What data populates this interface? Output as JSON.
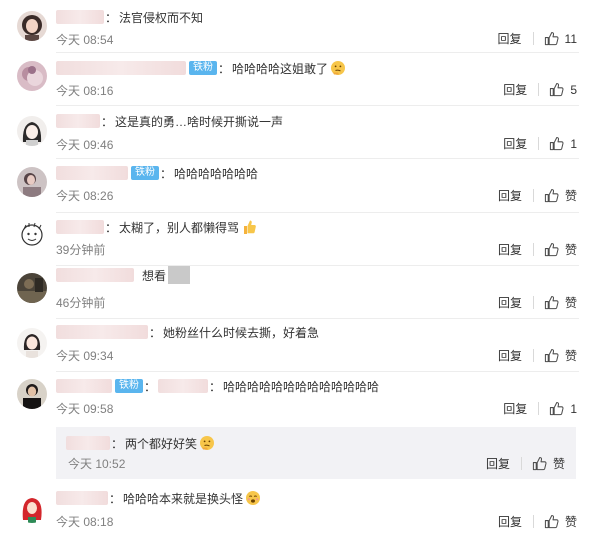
{
  "colors": {
    "badge": "#5ab5ee",
    "time": "#808080",
    "nested_bg": "#f2f2f5"
  },
  "comments": [
    {
      "text": "法官侵权而不知",
      "time": "今天 08:54",
      "reply": "回复",
      "like": "11",
      "avatar": "avatar-woman-dark-hair"
    },
    {
      "badge": "铁粉",
      "text": "哈哈哈哈这姐敢了",
      "emoji": "thinking-face-emoji",
      "time": "今天 08:16",
      "reply": "回复",
      "like": "5",
      "avatar": "avatar-blurred-pink"
    },
    {
      "text": "这是真的勇…啥时候开撕说一声",
      "time": "今天 09:46",
      "reply": "回复",
      "like": "1",
      "avatar": "avatar-anime-girl"
    },
    {
      "badge": "铁粉",
      "text": "哈哈哈哈哈哈哈",
      "time": "今天 08:26",
      "reply": "回复",
      "like": "赞",
      "avatar": "avatar-woman-reading"
    },
    {
      "text": "太糊了，别人都懒得骂",
      "emoji": "thumbs-up-emoji",
      "time": "39分钟前",
      "reply": "回复",
      "like": "赞",
      "avatar": "avatar-cartoon-face"
    },
    {
      "text": "想看",
      "redacted": true,
      "time": "46分钟前",
      "reply": "回复",
      "like": "赞",
      "avatar": "avatar-dark-photo"
    },
    {
      "text": "她粉丝什么时候去撕，好着急",
      "time": "今天 09:34",
      "reply": "回复",
      "like": "赞",
      "avatar": "avatar-woman-bob"
    },
    {
      "badge": "铁粉",
      "text": "哈哈哈哈哈哈哈哈哈哈哈哈哈",
      "time": "今天 09:58",
      "reply": "回复",
      "like": "1",
      "avatar": "avatar-man-black-shirt"
    },
    {
      "nested": true,
      "text": "两个都好好笑",
      "emoji": "thinking-face-emoji",
      "time": "今天 10:52",
      "reply": "回复",
      "like": "赞"
    },
    {
      "text": "哈哈哈本来就是换头怪",
      "emoji": "smirk-face-emoji",
      "time": "今天 08:18",
      "reply": "回复",
      "like": "赞",
      "avatar": "avatar-red-hair-cartoon"
    }
  ]
}
